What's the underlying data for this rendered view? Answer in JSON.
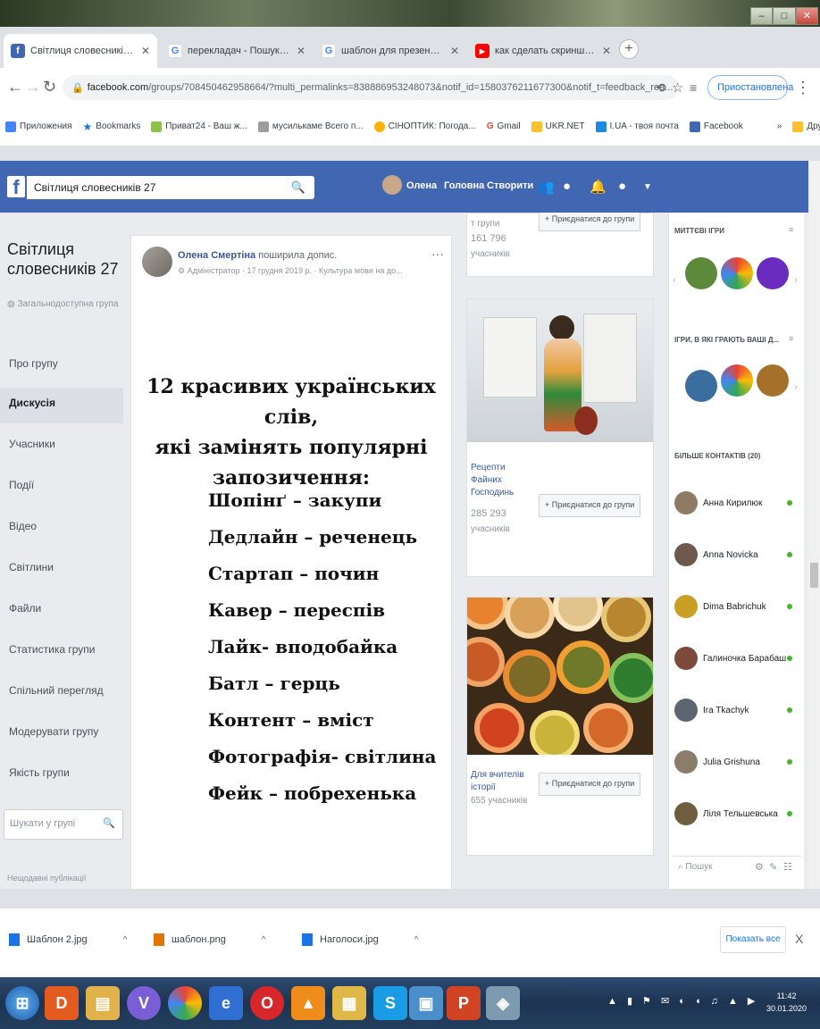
{
  "browser": {
    "tabs": [
      {
        "title": "Світлиця словесників 27",
        "favicon": "facebook-icon",
        "color": "#4267b2",
        "glyph": "f"
      },
      {
        "title": "перекладач - Пошук в Google",
        "favicon": "google-icon",
        "color": "#4285f4",
        "glyph": "G"
      },
      {
        "title": "шаблон для презентації - Go",
        "favicon": "google-icon",
        "color": "#4285f4",
        "glyph": "G"
      },
      {
        "title": "как сделать скриншот - YouTube",
        "favicon": "youtube-icon",
        "color": "#ff0000",
        "glyph": "▶"
      }
    ],
    "new_tab": "+",
    "window_controls": [
      "–",
      "□",
      "✕"
    ],
    "url_host": "facebook.com",
    "url_path": "/groups/708450462958664/?multi_permalinks=838886953248073&notif_id=1580376211677300&notif_t=feedback_rea...",
    "profile_label": "Приостановлена",
    "bookmarks": [
      {
        "label": "Приложения",
        "color": "#4285f4"
      },
      {
        "label": "Bookmarks",
        "color": "#1a73e8"
      },
      {
        "label": "Приват24 - Ваш ж...",
        "color": "#8bc34a"
      },
      {
        "label": "муcилькаме Всего п...",
        "color": "#9e9e9e"
      },
      {
        "label": "СІНОПТИК: Погода...",
        "color": "#ffb300"
      },
      {
        "label": "Gmail",
        "color": "#ea4335"
      },
      {
        "label": "UKR.NET",
        "color": "#fbc02d"
      },
      {
        "label": "I.UA - твоя почта",
        "color": "#1e88e5"
      },
      {
        "label": "Facebook",
        "color": "#4267b2"
      }
    ],
    "bookmarks_more": "»",
    "other_bookmarks": "Другие закладки"
  },
  "fb": {
    "search_value": "Світлиця словесників 27",
    "nav": [
      "Олена",
      "Головна",
      "Створити"
    ]
  },
  "group": {
    "title_line1": "Світлиця",
    "title_line2": "словесників 27",
    "subtitle": "Загальнодоступна група",
    "nav": [
      "Про групу",
      "Дискусія",
      "Учасники",
      "Події",
      "Відео",
      "Світлини",
      "Файли",
      "Статистика групи",
      "Спільний перегляд",
      "Модерувати групу",
      "Якість групи"
    ],
    "search_placeholder": "Шукати у групі",
    "footer": "Нещодавні публікації"
  },
  "post": {
    "author": "Олена Смертіна",
    "action": "поширила допис.",
    "meta": "Адміністратор · 17 грудня 2019 р. · Культура мови на до...",
    "heading_line1": "12 красивих українських слів,",
    "heading_line2": "які замінять популярні запозичення:",
    "words": [
      "Шопінґ – закупи",
      "Дедлайн – реченець",
      "Стартап – почин",
      "Кавер – переспів",
      "Лайк- вподобайка",
      "Батл – герць",
      "Контент – вміст",
      "Фотографія- світлина",
      "Фейк – побрехенька"
    ]
  },
  "suggestions": [
    {
      "name_top": "т групи",
      "members": "161 796",
      "members_label": "учасників",
      "join": "+ Приєднатися до групи"
    },
    {
      "name": [
        "Рецепти",
        "Файних",
        "Господинь"
      ],
      "members": "285 293",
      "members_label": "учасників",
      "join": "+ Приєднатися до групи"
    },
    {
      "name": [
        "Для вчителів",
        "історії"
      ],
      "members": "655 учасників",
      "join": "+ Приєднатися до групи"
    }
  ],
  "rightcol": {
    "instant_games": "МИТТЄВІ ІГРИ",
    "friends_games": "ІГРИ, В ЯКІ ГРАЮТЬ ВАШІ Д...",
    "more_contacts": "БІЛЬШЕ КОНТАКТІВ (20)",
    "contacts": [
      "Анна Кирилюк",
      "Anna Novicka",
      "Dima Babrichuk",
      "Галиночка Барабаш",
      "Ira Tkachyk",
      "Julia Grishuna",
      "Ліля Тельшевська"
    ],
    "search_placeholder": "Пошук"
  },
  "downloads": {
    "items": [
      "Шаблон 2.jpg",
      "шаблон.png",
      "Наголоси.jpg"
    ],
    "show_all": "Показать все",
    "close": "X"
  },
  "taskbar": {
    "time": "11:42",
    "date": "30.01.2020"
  }
}
